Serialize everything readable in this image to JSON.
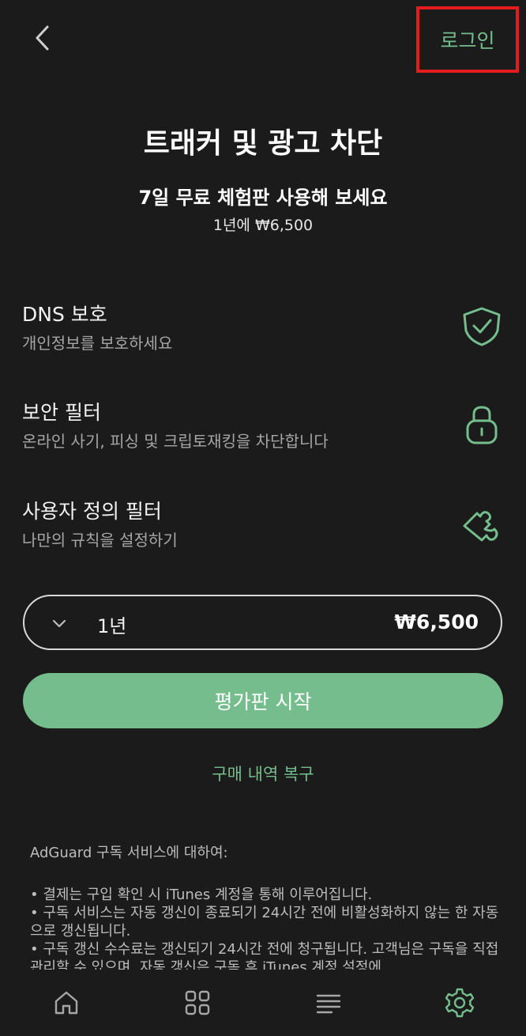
{
  "header": {
    "login_label": "로그인"
  },
  "title": "트래커 및 광고 차단",
  "trial": {
    "headline": "7일 무료 체험판 사용해 보세요",
    "price_line": "1년에 ₩6,500"
  },
  "features": [
    {
      "title": "DNS 보호",
      "description": "개인정보를 보호하세요",
      "icon": "shield-check-icon"
    },
    {
      "title": "보안 필터",
      "description": "온라인 사기, 피싱 및 크립토재킹을 차단합니다",
      "icon": "lock-icon"
    },
    {
      "title": "사용자 정의 필터",
      "description": "나만의 규칙을 설정하기",
      "icon": "puzzle-icon"
    }
  ],
  "plan_selector": {
    "period": "1년",
    "price": "₩6,500"
  },
  "cta_label": "평가판 시작",
  "restore_label": "구매 내역 복구",
  "about": {
    "heading": "AdGuard 구독 서비스에 대하여:",
    "terms": [
      "• 결제는 구입 확인 시 iTunes 계정을 통해 이루어집니다.",
      "• 구독 서비스는 자동 갱신이 종료되기 24시간 전에 비활성화하지 않는 한 자동으로 갱신됩니다.",
      "• 구독 갱신 수수료는 갱신되기 24시간 전에 청구됩니다. 고객님은 구독을 직접 관리할 수 있으며, 자동 갱신은 구독 후 iTunes 계정 설정에"
    ]
  },
  "tabbar": {
    "tabs": [
      {
        "name": "home",
        "icon": "home-icon"
      },
      {
        "name": "protection",
        "icon": "grid-icon"
      },
      {
        "name": "activity",
        "icon": "list-icon"
      },
      {
        "name": "settings",
        "icon": "gear-icon",
        "active": true
      }
    ]
  },
  "colors": {
    "accent": "#75bd8c",
    "background": "#1b1b1b",
    "highlight_box": "#e21c1c"
  }
}
